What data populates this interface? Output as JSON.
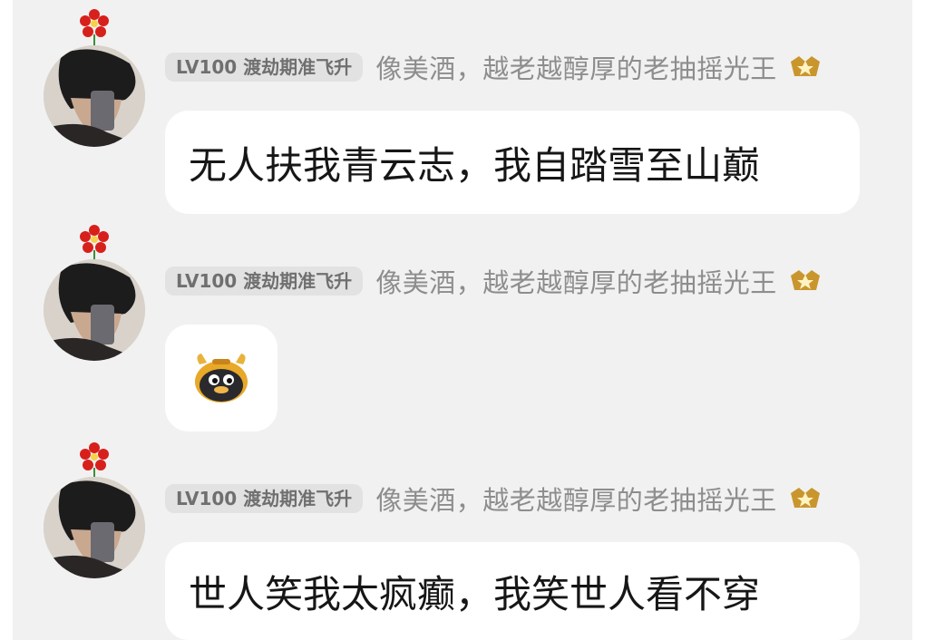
{
  "messages": [
    {
      "level": "LV100",
      "level_title": "渡劫期准飞升",
      "nickname": "像美酒，越老越醇厚的老抽摇光王",
      "text": "无人扶我青云志，我自踏雪至山巅",
      "type": "text"
    },
    {
      "level": "LV100",
      "level_title": "渡劫期准飞升",
      "nickname": "像美酒，越老越醇厚的老抽摇光王",
      "type": "emoji",
      "emoji": "ox-penguin-emoji"
    },
    {
      "level": "LV100",
      "level_title": "渡劫期准飞升",
      "nickname": "像美酒，越老越醇厚的老抽摇光王",
      "text": "世人笑我太疯癫，我笑世人看不穿",
      "type": "text"
    }
  ],
  "colors": {
    "background": "#f1f1f1",
    "bubble": "#ffffff",
    "level_badge_bg": "#e2e2e2",
    "nickname": "#8d8d8d",
    "flower": "#d7201c"
  },
  "icons": {
    "flower": "red-flower-icon",
    "badge": "gold-crown-badge-icon",
    "avatar": "user-avatar-photo"
  }
}
